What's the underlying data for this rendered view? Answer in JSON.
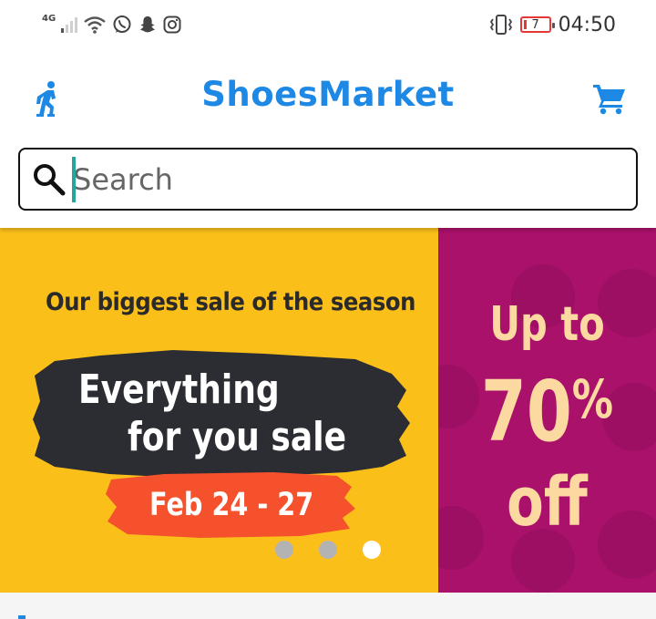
{
  "status_bar": {
    "network_label": "4G",
    "battery_level": "7",
    "time": "04:50",
    "icons": [
      "signal-icon",
      "wifi-icon",
      "whatsapp-icon",
      "snapchat-icon",
      "instagram-icon",
      "vibrate-icon",
      "battery-icon"
    ]
  },
  "header": {
    "app_title": "ShoesMarket",
    "left_icon": "walking-person-icon",
    "right_icon": "cart-icon",
    "accent_color": "#1e88e5"
  },
  "search": {
    "placeholder": "Search",
    "value": ""
  },
  "banner": {
    "tagline": "Our biggest sale of the season",
    "headline_line1": "Everything",
    "headline_line2": "for you sale",
    "dates": "Feb 24 - 27",
    "promo_line1": "Up to",
    "promo_percent": "70",
    "promo_percent_sign": "%",
    "promo_line2": "off",
    "colors": {
      "yellow": "#fbbf1a",
      "magenta": "#a9116a",
      "dark": "#2b2d33",
      "red": "#f4512c",
      "cream": "#fcd9a1"
    },
    "pager": {
      "count": 3,
      "active_index": 2
    }
  }
}
